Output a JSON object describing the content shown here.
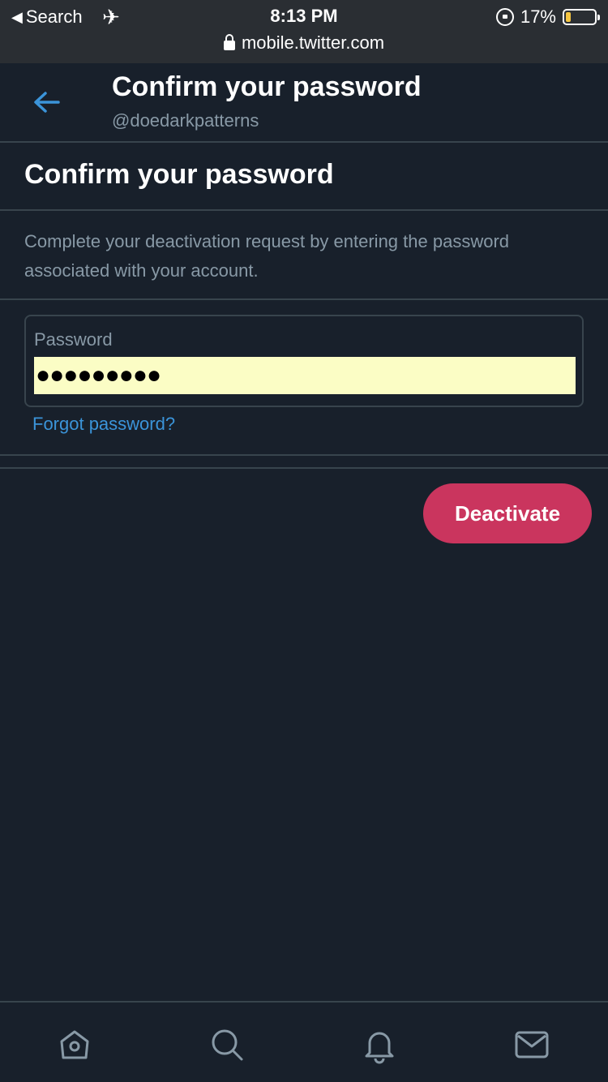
{
  "status_bar": {
    "back_label": "Search",
    "time": "8:13 PM",
    "battery_percent": "17%",
    "battery_level": 0.17,
    "url": "mobile.twitter.com"
  },
  "header": {
    "title": "Confirm your password",
    "handle": "@doedarkpatterns"
  },
  "main": {
    "section_title": "Confirm your password",
    "description": "Complete your deactivation request by entering the password associated with your account.",
    "password_label": "Password",
    "password_masked": "●●●●●●●●●",
    "forgot_link": "Forgot password?",
    "deactivate_label": "Deactivate"
  },
  "colors": {
    "background": "#18202b",
    "accent_blue": "#3b94d9",
    "deactivate_red": "#ca355e",
    "autofill_yellow": "#fbfdc5",
    "muted_text": "#8899a6"
  },
  "tabbar": {
    "icons": [
      "home-icon",
      "search-icon",
      "notifications-icon",
      "messages-icon"
    ]
  }
}
